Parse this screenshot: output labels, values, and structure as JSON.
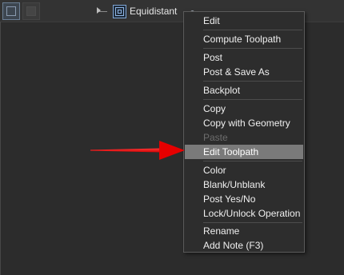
{
  "tree": {
    "operation_label": "Equidistant",
    "operation_icon": "equidistant-toolpath-icon"
  },
  "context_menu": {
    "items": [
      {
        "label": "Edit",
        "enabled": true
      },
      {
        "label": "Compute Toolpath",
        "enabled": true
      },
      {
        "label": "Post",
        "enabled": true
      },
      {
        "label": "Post & Save As",
        "enabled": true
      },
      {
        "label": "Backplot",
        "enabled": true
      },
      {
        "label": "Copy",
        "enabled": true
      },
      {
        "label": "Copy with Geometry",
        "enabled": true
      },
      {
        "label": "Paste",
        "enabled": false
      },
      {
        "label": "Edit Toolpath",
        "enabled": true,
        "highlighted": true
      },
      {
        "label": "Color",
        "enabled": true
      },
      {
        "label": "Blank/Unblank",
        "enabled": true
      },
      {
        "label": "Post Yes/No",
        "enabled": true
      },
      {
        "label": "Lock/Unlock Operation",
        "enabled": true
      },
      {
        "label": "Rename",
        "enabled": true
      },
      {
        "label": "Add Note (F3)",
        "enabled": true
      }
    ]
  },
  "annotation": {
    "arrow_color": "#e60000",
    "points_to": "Edit Toolpath"
  }
}
